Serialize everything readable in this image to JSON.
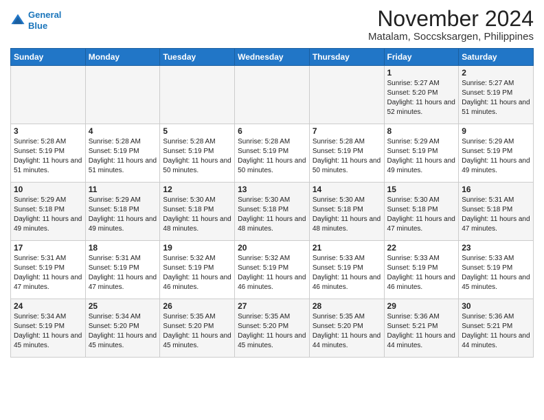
{
  "header": {
    "logo_line1": "General",
    "logo_line2": "Blue",
    "month_year": "November 2024",
    "location": "Matalam, Soccsksargen, Philippines"
  },
  "days_of_week": [
    "Sunday",
    "Monday",
    "Tuesday",
    "Wednesday",
    "Thursday",
    "Friday",
    "Saturday"
  ],
  "weeks": [
    [
      {
        "day": "",
        "info": ""
      },
      {
        "day": "",
        "info": ""
      },
      {
        "day": "",
        "info": ""
      },
      {
        "day": "",
        "info": ""
      },
      {
        "day": "",
        "info": ""
      },
      {
        "day": "1",
        "info": "Sunrise: 5:27 AM\nSunset: 5:20 PM\nDaylight: 11 hours\nand 52 minutes."
      },
      {
        "day": "2",
        "info": "Sunrise: 5:27 AM\nSunset: 5:19 PM\nDaylight: 11 hours\nand 51 minutes."
      }
    ],
    [
      {
        "day": "3",
        "info": "Sunrise: 5:28 AM\nSunset: 5:19 PM\nDaylight: 11 hours\nand 51 minutes."
      },
      {
        "day": "4",
        "info": "Sunrise: 5:28 AM\nSunset: 5:19 PM\nDaylight: 11 hours\nand 51 minutes."
      },
      {
        "day": "5",
        "info": "Sunrise: 5:28 AM\nSunset: 5:19 PM\nDaylight: 11 hours\nand 50 minutes."
      },
      {
        "day": "6",
        "info": "Sunrise: 5:28 AM\nSunset: 5:19 PM\nDaylight: 11 hours\nand 50 minutes."
      },
      {
        "day": "7",
        "info": "Sunrise: 5:28 AM\nSunset: 5:19 PM\nDaylight: 11 hours\nand 50 minutes."
      },
      {
        "day": "8",
        "info": "Sunrise: 5:29 AM\nSunset: 5:19 PM\nDaylight: 11 hours\nand 49 minutes."
      },
      {
        "day": "9",
        "info": "Sunrise: 5:29 AM\nSunset: 5:19 PM\nDaylight: 11 hours\nand 49 minutes."
      }
    ],
    [
      {
        "day": "10",
        "info": "Sunrise: 5:29 AM\nSunset: 5:18 PM\nDaylight: 11 hours\nand 49 minutes."
      },
      {
        "day": "11",
        "info": "Sunrise: 5:29 AM\nSunset: 5:18 PM\nDaylight: 11 hours\nand 49 minutes."
      },
      {
        "day": "12",
        "info": "Sunrise: 5:30 AM\nSunset: 5:18 PM\nDaylight: 11 hours\nand 48 minutes."
      },
      {
        "day": "13",
        "info": "Sunrise: 5:30 AM\nSunset: 5:18 PM\nDaylight: 11 hours\nand 48 minutes."
      },
      {
        "day": "14",
        "info": "Sunrise: 5:30 AM\nSunset: 5:18 PM\nDaylight: 11 hours\nand 48 minutes."
      },
      {
        "day": "15",
        "info": "Sunrise: 5:30 AM\nSunset: 5:18 PM\nDaylight: 11 hours\nand 47 minutes."
      },
      {
        "day": "16",
        "info": "Sunrise: 5:31 AM\nSunset: 5:18 PM\nDaylight: 11 hours\nand 47 minutes."
      }
    ],
    [
      {
        "day": "17",
        "info": "Sunrise: 5:31 AM\nSunset: 5:19 PM\nDaylight: 11 hours\nand 47 minutes."
      },
      {
        "day": "18",
        "info": "Sunrise: 5:31 AM\nSunset: 5:19 PM\nDaylight: 11 hours\nand 47 minutes."
      },
      {
        "day": "19",
        "info": "Sunrise: 5:32 AM\nSunset: 5:19 PM\nDaylight: 11 hours\nand 46 minutes."
      },
      {
        "day": "20",
        "info": "Sunrise: 5:32 AM\nSunset: 5:19 PM\nDaylight: 11 hours\nand 46 minutes."
      },
      {
        "day": "21",
        "info": "Sunrise: 5:33 AM\nSunset: 5:19 PM\nDaylight: 11 hours\nand 46 minutes."
      },
      {
        "day": "22",
        "info": "Sunrise: 5:33 AM\nSunset: 5:19 PM\nDaylight: 11 hours\nand 46 minutes."
      },
      {
        "day": "23",
        "info": "Sunrise: 5:33 AM\nSunset: 5:19 PM\nDaylight: 11 hours\nand 45 minutes."
      }
    ],
    [
      {
        "day": "24",
        "info": "Sunrise: 5:34 AM\nSunset: 5:19 PM\nDaylight: 11 hours\nand 45 minutes."
      },
      {
        "day": "25",
        "info": "Sunrise: 5:34 AM\nSunset: 5:20 PM\nDaylight: 11 hours\nand 45 minutes."
      },
      {
        "day": "26",
        "info": "Sunrise: 5:35 AM\nSunset: 5:20 PM\nDaylight: 11 hours\nand 45 minutes."
      },
      {
        "day": "27",
        "info": "Sunrise: 5:35 AM\nSunset: 5:20 PM\nDaylight: 11 hours\nand 45 minutes."
      },
      {
        "day": "28",
        "info": "Sunrise: 5:35 AM\nSunset: 5:20 PM\nDaylight: 11 hours\nand 44 minutes."
      },
      {
        "day": "29",
        "info": "Sunrise: 5:36 AM\nSunset: 5:21 PM\nDaylight: 11 hours\nand 44 minutes."
      },
      {
        "day": "30",
        "info": "Sunrise: 5:36 AM\nSunset: 5:21 PM\nDaylight: 11 hours\nand 44 minutes."
      }
    ]
  ]
}
